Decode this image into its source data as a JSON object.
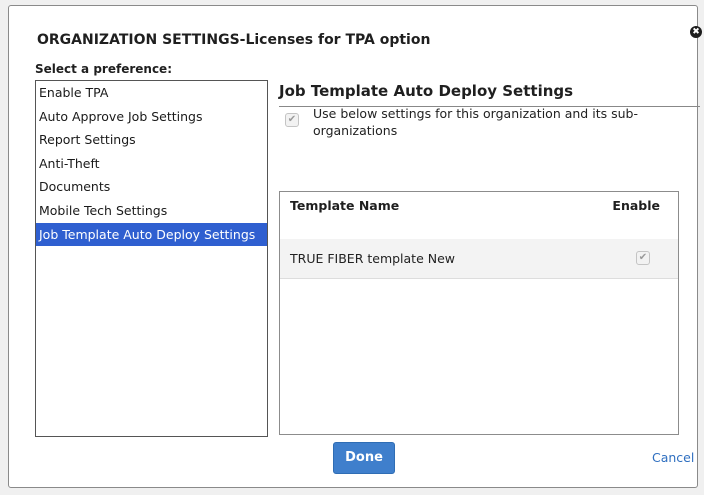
{
  "dialog": {
    "title": "ORGANIZATION SETTINGS-Licenses for TPA option",
    "close_icon": "✖"
  },
  "sidebar": {
    "label": "Select a preference:",
    "items": [
      {
        "label": "Enable TPA",
        "selected": false
      },
      {
        "label": "Auto Approve Job Settings",
        "selected": false
      },
      {
        "label": "Report Settings",
        "selected": false
      },
      {
        "label": "Anti-Theft",
        "selected": false
      },
      {
        "label": "Documents",
        "selected": false
      },
      {
        "label": "Mobile Tech Settings",
        "selected": false
      },
      {
        "label": "Job Template Auto Deploy Settings",
        "selected": true
      }
    ]
  },
  "main": {
    "section_title": "Job Template Auto Deploy Settings",
    "use_settings": {
      "label": "Use below settings for this organization and its sub-organizations",
      "checked": true
    },
    "table": {
      "columns": [
        "Template Name",
        "Enable"
      ],
      "rows": [
        {
          "name": "TRUE FIBER template New",
          "enabled": true
        }
      ]
    }
  },
  "footer": {
    "done_label": "Done",
    "cancel_label": "Cancel"
  },
  "colors": {
    "selected_item_bg": "#2f5fd0",
    "done_button_bg": "#3f7fcc",
    "cancel_link": "#2f6fc0"
  }
}
